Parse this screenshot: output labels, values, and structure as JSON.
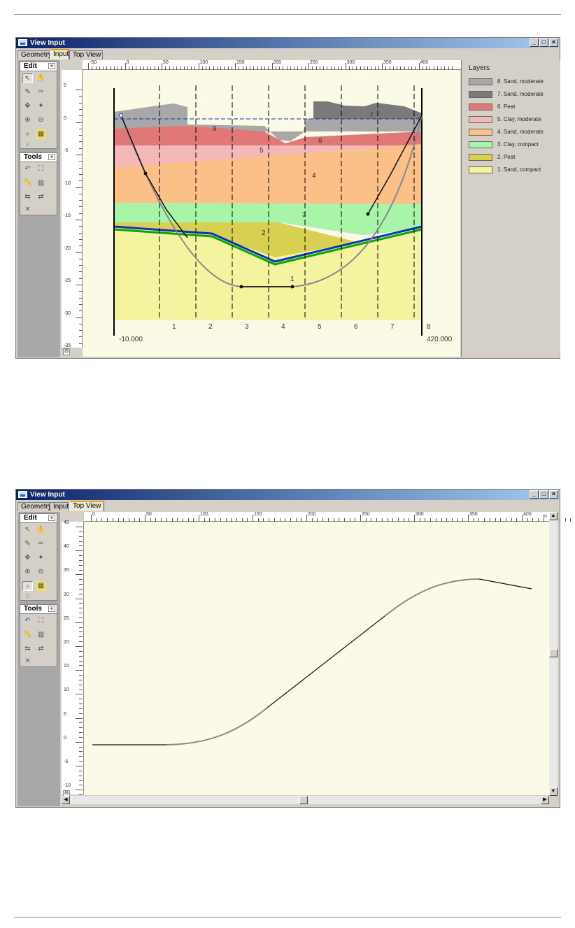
{
  "window1": {
    "title": "View Input",
    "tabs": [
      "Geometry",
      "Input",
      "Top View"
    ],
    "active_tab": 1
  },
  "window2": {
    "title": "View Input",
    "tabs": [
      "Geometry",
      "Input",
      "Top View"
    ],
    "active_tab": 2
  },
  "window_buttons": {
    "minimize": "_",
    "maximize": "□",
    "close": "×"
  },
  "toolbox": {
    "edit_label": "Edit",
    "tools_label": "Tools",
    "collapse_glyph": "«"
  },
  "ruler1": {
    "h_ticks": [
      "-50",
      "0",
      "50",
      "100",
      "150",
      "200",
      "250",
      "300",
      "350",
      "400"
    ],
    "h_unit": "m",
    "v_ticks": [
      "5",
      "0",
      "-5",
      "-10",
      "-15",
      "-20",
      "-25",
      "-30",
      "-35"
    ],
    "corner": "⊟"
  },
  "ruler2": {
    "h_ticks": [
      "0",
      "50",
      "100",
      "150",
      "200",
      "250",
      "300",
      "350",
      "400"
    ],
    "h_unit": "m",
    "v_ticks": [
      "45",
      "40",
      "35",
      "30",
      "25",
      "20",
      "15",
      "10",
      "5",
      "0",
      "-5",
      "-10"
    ],
    "corner": "⊟"
  },
  "legend": {
    "title": "Layers",
    "items": [
      {
        "label": "8. Sand, moderate",
        "color": "#a8a8a8"
      },
      {
        "label": "7. Sand, moderate",
        "color": "#7a7a7a"
      },
      {
        "label": "6. Peat",
        "color": "#e07878"
      },
      {
        "label": "5. Clay, moderate",
        "color": "#f4b8b8"
      },
      {
        "label": "4. Sand, moderate",
        "color": "#fbc088"
      },
      {
        "label": "3. Clay, compact",
        "color": "#a8f4a8"
      },
      {
        "label": "2. Peat",
        "color": "#d8d050"
      },
      {
        "label": "1. Sand, compact",
        "color": "#f4f4a0"
      }
    ]
  },
  "cross_section": {
    "layer_numbers": [
      "8",
      "7",
      "6",
      "5",
      "4",
      "3",
      "2",
      "1"
    ],
    "vertical_numbers": [
      "1",
      "2",
      "3",
      "4",
      "5",
      "6",
      "7",
      "8"
    ],
    "left_bound": "-10.000",
    "right_bound": "420.000"
  }
}
